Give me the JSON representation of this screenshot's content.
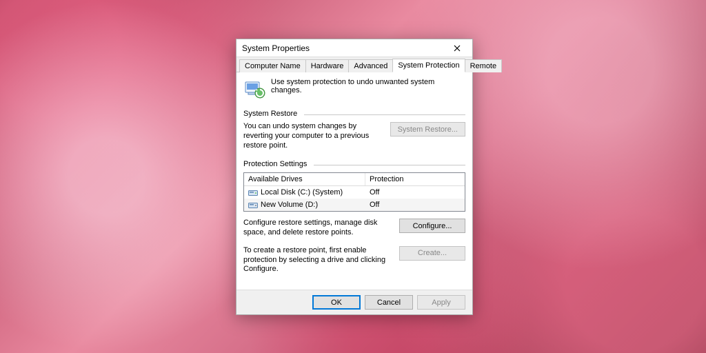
{
  "dialog": {
    "title": "System Properties",
    "tabs": [
      {
        "label": "Computer Name"
      },
      {
        "label": "Hardware"
      },
      {
        "label": "Advanced"
      },
      {
        "label": "System Protection",
        "active": true
      },
      {
        "label": "Remote"
      }
    ],
    "intro_text": "Use system protection to undo unwanted system changes.",
    "restore": {
      "legend": "System Restore",
      "text": "You can undo system changes by reverting your computer to a previous restore point.",
      "button": "System Restore..."
    },
    "protection": {
      "legend": "Protection Settings",
      "col_drives": "Available Drives",
      "col_prot": "Protection",
      "drives": [
        {
          "name": "Local Disk (C:) (System)",
          "status": "Off"
        },
        {
          "name": "New Volume (D:)",
          "status": "Off"
        }
      ],
      "configure_text": "Configure restore settings, manage disk space, and delete restore points.",
      "configure_button": "Configure...",
      "create_text": "To create a restore point, first enable protection by selecting a drive and clicking Configure.",
      "create_button": "Create..."
    },
    "buttons": {
      "ok": "OK",
      "cancel": "Cancel",
      "apply": "Apply"
    }
  }
}
